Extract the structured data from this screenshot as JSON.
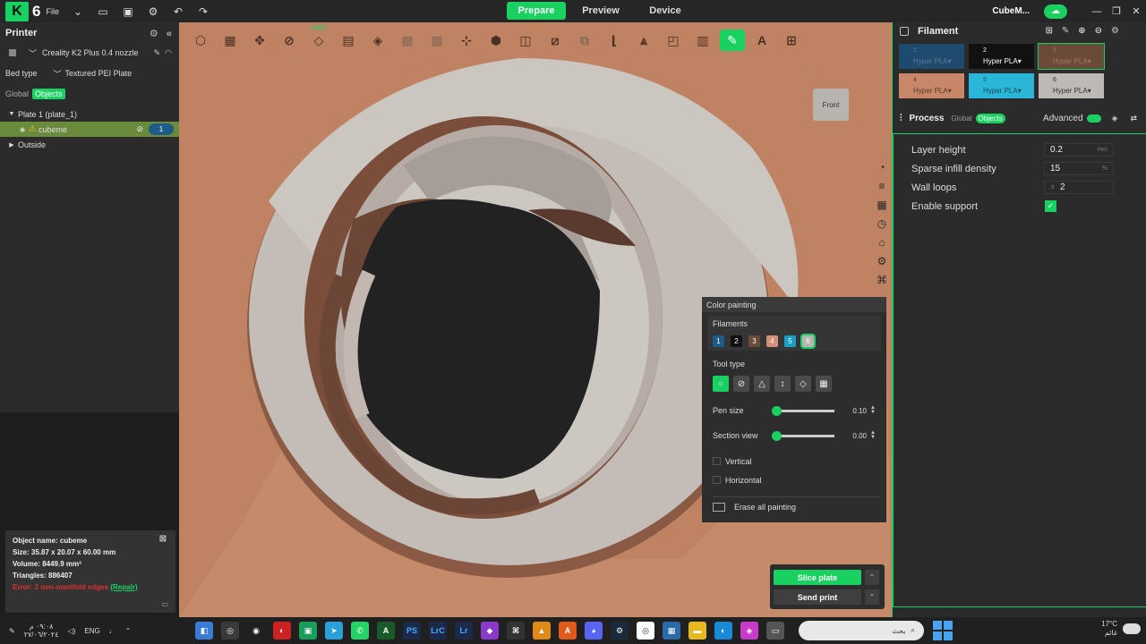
{
  "titlebar": {
    "version": "6",
    "file_label": "File",
    "tabs": [
      {
        "label": "Prepare",
        "active": true
      },
      {
        "label": "Preview",
        "active": false
      },
      {
        "label": "Device",
        "active": false
      }
    ],
    "project_name": "CubeM..."
  },
  "left": {
    "printer_title": "Printer",
    "printer_name": "Creality K2 Plus 0.4 nozzle",
    "bed_type_label": "Bed type",
    "bed_type_value": "Textured PEI Plate",
    "seg_global": "Global",
    "seg_objects": "Objects",
    "tree": {
      "plate": "Plate 1 (plate_1)",
      "object": "cubeme",
      "object_badge": "1",
      "outside": "Outside"
    }
  },
  "viewport": {
    "front_label": "Front",
    "auto_label": "AUTO"
  },
  "color_painting": {
    "title": "Color painting",
    "filaments_label": "Filaments",
    "filaments": [
      {
        "num": "1",
        "color": "#1e5b86"
      },
      {
        "num": "2",
        "color": "#111111"
      },
      {
        "num": "3",
        "color": "#6b4a3a"
      },
      {
        "num": "4",
        "color": "#d4907a"
      },
      {
        "num": "5",
        "color": "#1a9fc6"
      },
      {
        "num": "6",
        "color": "#b8b4b0"
      }
    ],
    "tool_type_label": "Tool type",
    "pen_size_label": "Pen size",
    "pen_size_value": "0.10",
    "section_view_label": "Section view",
    "section_view_value": "0.00",
    "vertical_label": "Vertical",
    "horizontal_label": "Horizontal",
    "erase_label": "Erase all painting"
  },
  "object_info": {
    "name": "Object name: cubeme",
    "size": "Size: 35.87 x 20.07 x 60.00 mm",
    "volume": "Volume: 8449.9 mm³",
    "triangles": "Triangles: 886407",
    "error": "Error: 3 non-manifold edges",
    "repair": "(Repair)"
  },
  "slice": {
    "slice_plate": "Slice plate",
    "send_print": "Send print"
  },
  "right": {
    "filament_title": "Filament",
    "filaments": [
      {
        "num": "1",
        "type": "Hyper PLA",
        "bg": "#1e4a6e",
        "fg": "#5a7a96"
      },
      {
        "num": "2",
        "type": "Hyper PLA",
        "bg": "#111111",
        "fg": "#ffffff"
      },
      {
        "num": "3",
        "type": "Hyper PLA",
        "bg": "#6b4a3a",
        "fg": "#9a7a6a"
      },
      {
        "num": "4",
        "type": "Hyper PLA",
        "bg": "#c9876a",
        "fg": "#5a3828"
      },
      {
        "num": "5",
        "type": "Hyper PLA",
        "bg": "#2ab6d6",
        "fg": "#1a4a5a"
      },
      {
        "num": "6",
        "type": "Hyper PLA",
        "bg": "#bdb9b5",
        "fg": "#333333"
      }
    ],
    "process_title": "Process",
    "seg_global": "Global",
    "seg_objects": "Objects",
    "advanced_label": "Advanced",
    "params": [
      {
        "label": "Layer height",
        "value": "0.2",
        "unit": "mm"
      },
      {
        "label": "Sparse infill density",
        "value": "15",
        "unit": "%"
      },
      {
        "label": "Wall loops",
        "value": "2",
        "unit": ""
      }
    ],
    "enable_support_label": "Enable support"
  },
  "taskbar": {
    "time": "٠٩:٠٨ م",
    "date": "٢٧/٠٦/٢٠٢٤",
    "lang": "ENG",
    "search_placeholder": "بحث",
    "temp": "17°C",
    "weather_text": "غائم",
    "apps": [
      {
        "label": "PS",
        "color": "#1b2a4a"
      },
      {
        "label": "LrC",
        "color": "#1b2a4a"
      },
      {
        "label": "Lr",
        "color": "#1b2a4a"
      }
    ]
  }
}
